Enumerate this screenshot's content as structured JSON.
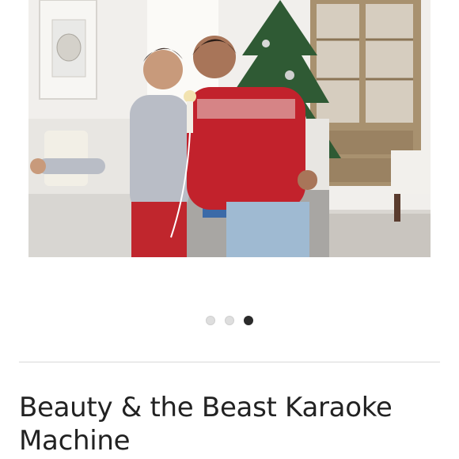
{
  "product": {
    "title": "Beauty & the Beast Karaoke Machine",
    "image": {
      "alt": "Two girls singing into a karaoke microphone in a living room with a Christmas tree"
    }
  },
  "carousel": {
    "slide_count": 3,
    "active_index": 2,
    "dots": [
      {
        "state": "inactive"
      },
      {
        "state": "inactive"
      },
      {
        "state": "active"
      }
    ],
    "colors": {
      "active": "#2b2b2b",
      "inactive": "#dedede"
    }
  }
}
